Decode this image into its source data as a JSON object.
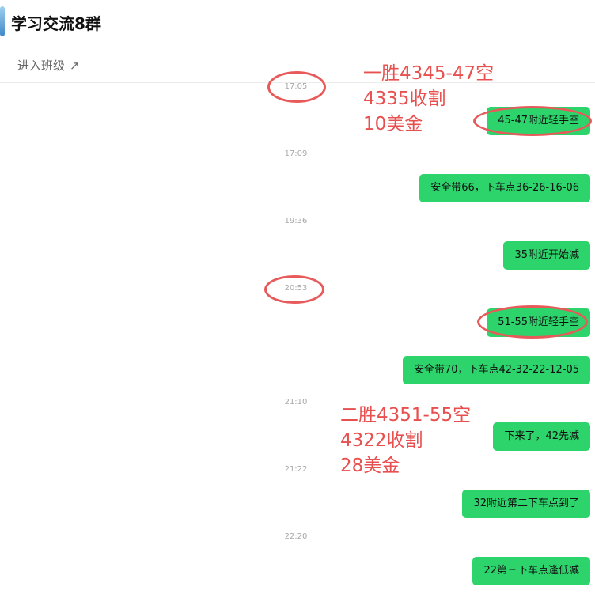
{
  "header": {
    "title": "学习交流8群",
    "class_link": "进入班级",
    "class_link_icon": "↗"
  },
  "messages": [
    {
      "time": "17:05",
      "text": "45-47附近轻手空"
    },
    {
      "time": "17:09",
      "text": "安全带66，下车点36-26-16-06"
    },
    {
      "time": "19:36",
      "text": "35附近开始减"
    },
    {
      "time": "20:53",
      "text": "51-55附近轻手空"
    },
    {
      "time": "",
      "text": "安全带70，下车点42-32-22-12-05"
    },
    {
      "time": "21:10",
      "text": "下来了，42先减"
    },
    {
      "time": "21:22",
      "text": "32附近第二下车点到了"
    },
    {
      "time": "22:20",
      "text": "22第三下车点逢低减"
    }
  ],
  "annotations": [
    {
      "lines": [
        "一胜4345-47空",
        "4335收割",
        "10美金"
      ]
    },
    {
      "lines": [
        "二胜4351-55空",
        "4322收割",
        "28美金"
      ]
    }
  ],
  "colors": {
    "bubble": "#2dd36b",
    "annotation": "#e85050"
  }
}
